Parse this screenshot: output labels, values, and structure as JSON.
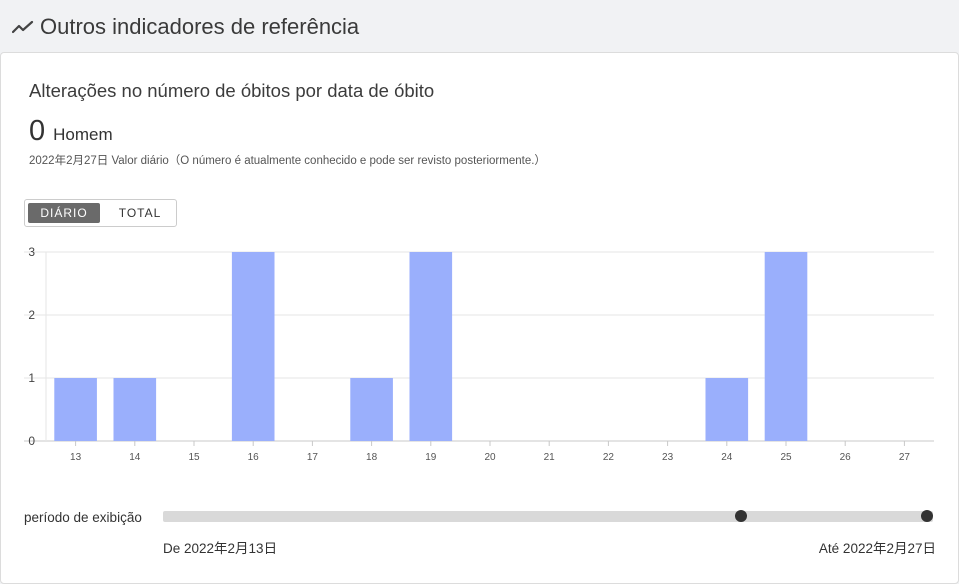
{
  "header": {
    "title": "Outros indicadores de referência",
    "icon": "trend-line-icon"
  },
  "card": {
    "title": "Alterações no número de óbitos por data de óbito",
    "value": "0",
    "unit": "Homem",
    "note": "2022年2月27日 Valor diário（O número é atualmente conhecido e pode ser revisto posteriormente.）"
  },
  "toggle": {
    "daily_label": "DIÁRIO",
    "total_label": "TOTAL",
    "active": "daily"
  },
  "slider": {
    "label": "período de exibição",
    "from_label": "De 2022年2月13日",
    "to_label": "Até 2022年2月27日",
    "start_fraction": 0.75,
    "end_fraction": 1.0
  },
  "colors": {
    "bar": "#9aaffc",
    "grid": "#e6e6e6",
    "axis": "#c8c8c8",
    "handle": "#333333",
    "track": "#d9d9d9"
  },
  "chart_data": {
    "type": "bar",
    "categories": [
      "13",
      "14",
      "15",
      "16",
      "17",
      "18",
      "19",
      "20",
      "21",
      "22",
      "23",
      "24",
      "25",
      "26",
      "27"
    ],
    "values": [
      1,
      1,
      0,
      3,
      0,
      1,
      3,
      0,
      0,
      0,
      0,
      1,
      3,
      0,
      0
    ],
    "ylim": [
      0,
      3
    ],
    "yticks": [
      0,
      1,
      2,
      3
    ],
    "grid": true,
    "title": "",
    "xlabel": "",
    "ylabel": ""
  }
}
